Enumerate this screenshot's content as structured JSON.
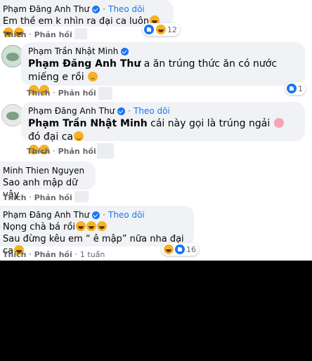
{
  "comments": [
    {
      "name": "Phạm Đăng Anh Thư",
      "follow": "Theo dõi",
      "text": "Em thề em k nhìn ra đại ca luôn",
      "like": "Thích",
      "reply": "Phản hồi",
      "reactions": "12"
    },
    {
      "name": "Phạm Trần Nhật Minh",
      "mention": "Phạm Đăng Anh Thư",
      "text": " a ăn trúng thức ăn có nước miếng e rồi",
      "like": "Thích",
      "reply": "Phản hồi",
      "reactions": "1"
    },
    {
      "name": "Phạm Đăng Anh Thư",
      "follow": "Theo dõi",
      "mention": "Phạm Trần Nhật Minh",
      "text": " cái này gọi là trúng ngải",
      "text2": " đó đại ca",
      "like": "Thích",
      "reply": "Phản hồi"
    },
    {
      "name": "Minh Thien Nguyen",
      "text": "Sao anh mập dữ vậy",
      "like": "Thích",
      "reply": "Phản hồi"
    },
    {
      "name": "Phạm Đăng Anh Thư",
      "follow": "Theo dõi",
      "line1": "Nọng chà bá rồi",
      "line2": "Sau đừng kêu em “ ê mập” nữa nha đại ca",
      "like": "Thích",
      "reply": "Phản hồi",
      "time": "1 tuần",
      "reactions": "16"
    }
  ]
}
